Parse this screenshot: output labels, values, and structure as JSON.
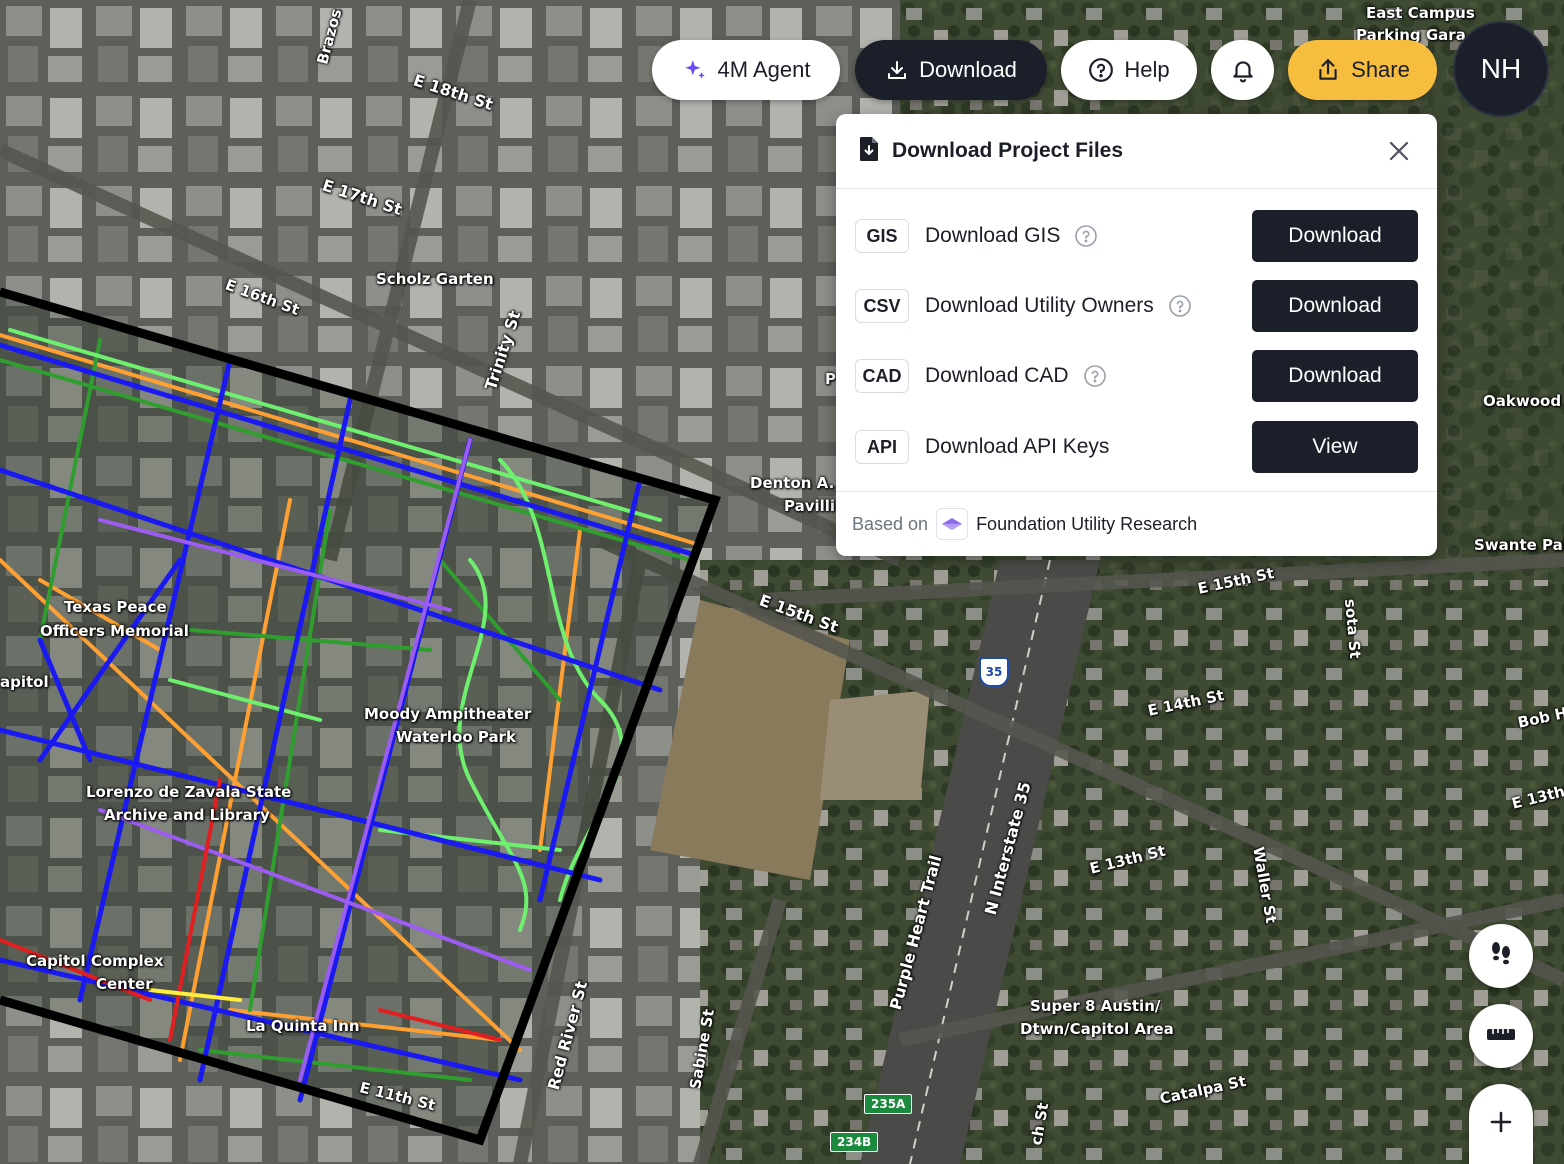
{
  "toolbar": {
    "agent_label": "4M Agent",
    "download_label": "Download",
    "help_label": "Help",
    "share_label": "Share",
    "avatar_initials": "NH"
  },
  "download_panel": {
    "title": "Download Project Files",
    "rows": [
      {
        "tag": "GIS",
        "label": "Download GIS",
        "has_help": true,
        "button": "Download"
      },
      {
        "tag": "CSV",
        "label": "Download Utility Owners",
        "has_help": true,
        "button": "Download"
      },
      {
        "tag": "CAD",
        "label": "Download CAD",
        "has_help": true,
        "button": "Download"
      },
      {
        "tag": "API",
        "label": "Download API Keys",
        "has_help": false,
        "button": "View"
      }
    ],
    "footer_prefix": "Based on",
    "footer_source": "Foundation Utility Research"
  },
  "map": {
    "labels": {
      "e18": "E 18th St",
      "e17": "E 17th St",
      "e16": "E 16th St",
      "brazos": "Brazos",
      "scholz": "Scholz Garten",
      "trinity": "Trinity St",
      "east_campus_1": "East Campus",
      "east_campus_2": "Parking Gara",
      "oakwood": "Oakwood",
      "denton_1": "Denton A.",
      "denton_2": "Pavilli",
      "swante": "Swante Palm",
      "e15_a": "E 15th St",
      "e15_b": "E 15th St",
      "e14": "E 14th St",
      "e13_a": "E 13th St",
      "e13_b": "E 13th",
      "sota": "sota St",
      "bob": "Bob H",
      "waller": "Waller St",
      "ni35": "N Interstate 35",
      "purple": "Purple Heart Trail",
      "red_river": "Red River St",
      "sabine": "Sabine St",
      "super8_1": "Super 8 Austin/",
      "super8_2": "Dtwn/Capitol Area",
      "catalpa": "Catalpa St",
      "texas_1": "Texas Peace",
      "texas_2": "Officers Memorial",
      "capitol": "apitol",
      "moody_1": "Moody Ampitheater",
      "moody_2": "Waterloo Park",
      "lorenzo_1": "Lorenzo de Zavala State",
      "lorenzo_2": "Archive and Library",
      "capcomplex_1": "Capitol Complex",
      "capcomplex_2": "Center",
      "laquinta": "La Quinta Inn",
      "e11": "E 11th St",
      "sth_st": "ch St",
      "p_edge": "P"
    },
    "shields": {
      "i35": "35",
      "exit_a": "235A",
      "exit_b": "234B"
    },
    "icons": [
      "footsteps-icon",
      "ruler-icon",
      "plus-icon"
    ],
    "colors": {
      "water": "#1a1af0",
      "gas": "#ffa033",
      "telecom": "#2f9e2f",
      "light_green": "#6ef06e",
      "electric": "#e02020",
      "purple": "#9b5cf0",
      "boundary": "#000000"
    }
  }
}
